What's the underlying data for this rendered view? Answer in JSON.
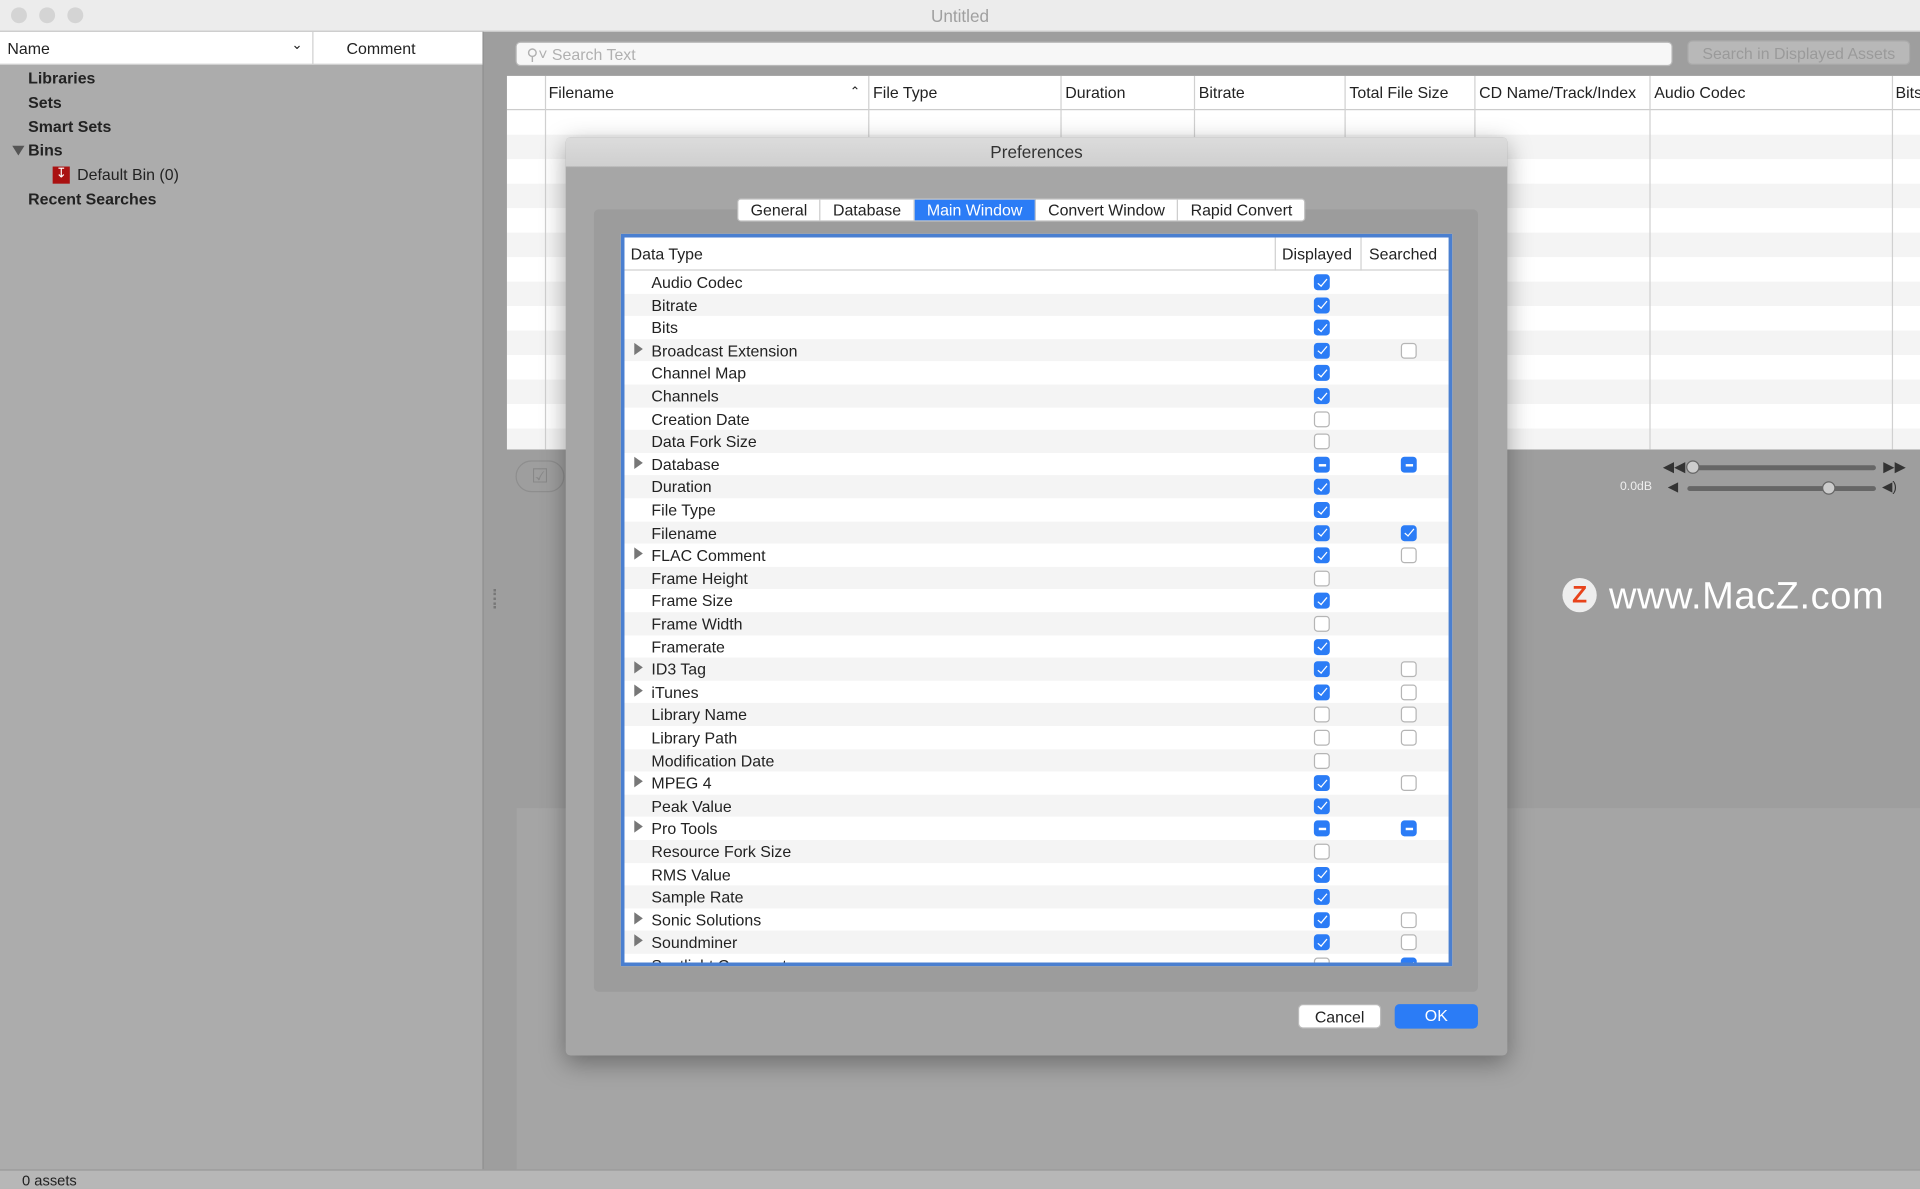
{
  "window": {
    "title": "Untitled"
  },
  "sidebar": {
    "col_name": "Name",
    "col_comment": "Comment",
    "items": [
      {
        "label": "Libraries"
      },
      {
        "label": "Sets"
      },
      {
        "label": "Smart Sets"
      },
      {
        "label": "Bins",
        "expanded": true
      },
      {
        "label": "Default Bin (0)"
      },
      {
        "label": "Recent Searches"
      }
    ]
  },
  "search": {
    "placeholder": "Search Text",
    "button": "Search in Displayed Assets"
  },
  "asset_table": {
    "columns": [
      "Filename",
      "File Type",
      "Duration",
      "Bitrate",
      "Total File Size",
      "CD Name/Track/Index",
      "Audio Codec",
      "Bits"
    ],
    "sort_column": "Filename",
    "sort": "ascending"
  },
  "player": {
    "gain": "0.0dB"
  },
  "watermark": "www.MacZ.com",
  "status": {
    "text": "0 assets"
  },
  "preferences": {
    "title": "Preferences",
    "tabs": [
      {
        "label": "General"
      },
      {
        "label": "Database"
      },
      {
        "label": "Main Window",
        "selected": true
      },
      {
        "label": "Convert Window"
      },
      {
        "label": "Rapid Convert"
      }
    ],
    "columns": {
      "type": "Data Type",
      "displayed": "Displayed",
      "searched": "Searched"
    },
    "rows": [
      {
        "label": "Audio Codec",
        "expandable": false,
        "displayed": "on",
        "searched": null
      },
      {
        "label": "Bitrate",
        "expandable": false,
        "displayed": "on",
        "searched": null
      },
      {
        "label": "Bits",
        "expandable": false,
        "displayed": "on",
        "searched": null
      },
      {
        "label": "Broadcast Extension",
        "expandable": true,
        "displayed": "on",
        "searched": "off"
      },
      {
        "label": "Channel Map",
        "expandable": false,
        "displayed": "on",
        "searched": null
      },
      {
        "label": "Channels",
        "expandable": false,
        "displayed": "on",
        "searched": null
      },
      {
        "label": "Creation Date",
        "expandable": false,
        "displayed": "off",
        "searched": null
      },
      {
        "label": "Data Fork Size",
        "expandable": false,
        "displayed": "off",
        "searched": null
      },
      {
        "label": "Database",
        "expandable": true,
        "displayed": "mixed",
        "searched": "mixed"
      },
      {
        "label": "Duration",
        "expandable": false,
        "displayed": "on",
        "searched": null
      },
      {
        "label": "File Type",
        "expandable": false,
        "displayed": "on",
        "searched": null
      },
      {
        "label": "Filename",
        "expandable": false,
        "displayed": "on",
        "searched": "on"
      },
      {
        "label": "FLAC Comment",
        "expandable": true,
        "displayed": "on",
        "searched": "off"
      },
      {
        "label": "Frame Height",
        "expandable": false,
        "displayed": "off",
        "searched": null
      },
      {
        "label": "Frame Size",
        "expandable": false,
        "displayed": "on",
        "searched": null
      },
      {
        "label": "Frame Width",
        "expandable": false,
        "displayed": "off",
        "searched": null
      },
      {
        "label": "Framerate",
        "expandable": false,
        "displayed": "on",
        "searched": null
      },
      {
        "label": "ID3 Tag",
        "expandable": true,
        "displayed": "on",
        "searched": "off"
      },
      {
        "label": "iTunes",
        "expandable": true,
        "displayed": "on",
        "searched": "off"
      },
      {
        "label": "Library Name",
        "expandable": false,
        "displayed": "off",
        "searched": "off"
      },
      {
        "label": "Library Path",
        "expandable": false,
        "displayed": "off",
        "searched": "off"
      },
      {
        "label": "Modification Date",
        "expandable": false,
        "displayed": "off",
        "searched": null
      },
      {
        "label": "MPEG 4",
        "expandable": true,
        "displayed": "on",
        "searched": "off"
      },
      {
        "label": "Peak Value",
        "expandable": false,
        "displayed": "on",
        "searched": null
      },
      {
        "label": "Pro Tools",
        "expandable": true,
        "displayed": "mixed",
        "searched": "mixed"
      },
      {
        "label": "Resource Fork Size",
        "expandable": false,
        "displayed": "off",
        "searched": null
      },
      {
        "label": "RMS Value",
        "expandable": false,
        "displayed": "on",
        "searched": null
      },
      {
        "label": "Sample Rate",
        "expandable": false,
        "displayed": "on",
        "searched": null
      },
      {
        "label": "Sonic Solutions",
        "expandable": true,
        "displayed": "on",
        "searched": "off"
      },
      {
        "label": "Soundminer",
        "expandable": true,
        "displayed": "on",
        "searched": "off"
      },
      {
        "label": "Spotlight Comment",
        "expandable": false,
        "displayed": "off",
        "searched": "on"
      }
    ],
    "cancel": "Cancel",
    "ok": "OK",
    "accent": "#2b7cf6"
  }
}
